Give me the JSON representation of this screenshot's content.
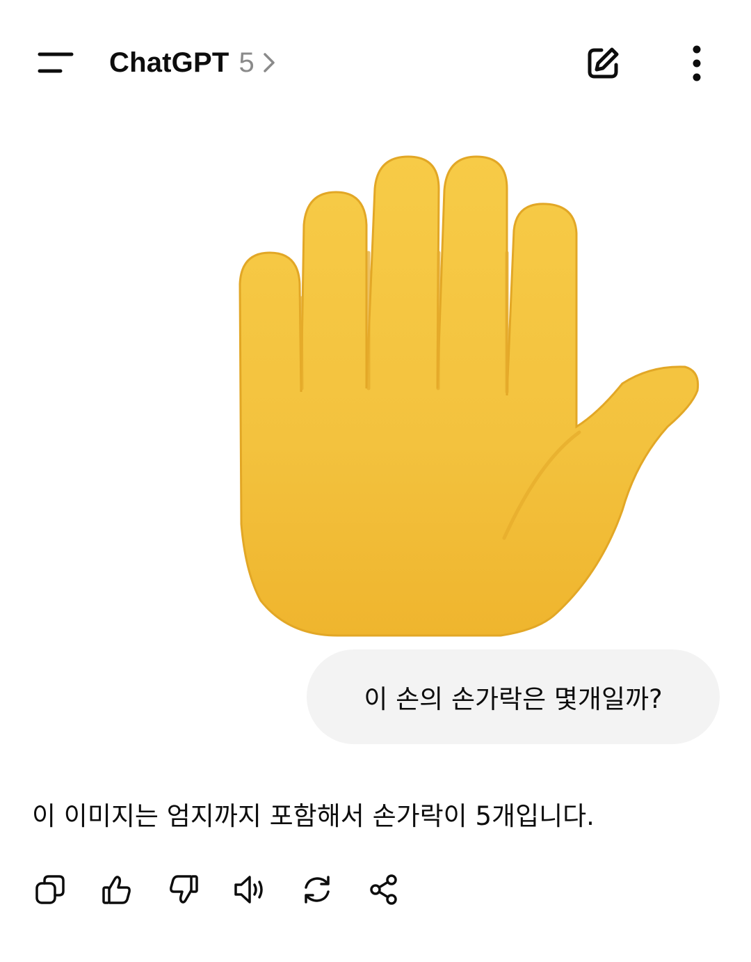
{
  "header": {
    "title": "ChatGPT",
    "version": "5",
    "icons": {
      "menu": "menu-icon",
      "chevron": "chevron-right-icon",
      "new_chat": "edit-icon",
      "more": "more-vertical-icon"
    }
  },
  "conversation": {
    "user_image": {
      "icon": "raised-hand-emoji-image",
      "colors": {
        "hand": "#F5C542",
        "shadow": "#E0A820"
      }
    },
    "user_message": "이 손의 손가락은 몇개일까?",
    "assistant_message": "이 이미지는 엄지까지 포함해서 손가락이 5개입니다."
  },
  "actions": [
    {
      "name": "copy",
      "icon": "copy-icon"
    },
    {
      "name": "good-response",
      "icon": "thumbs-up-icon"
    },
    {
      "name": "bad-response",
      "icon": "thumbs-down-icon"
    },
    {
      "name": "read-aloud",
      "icon": "speaker-icon"
    },
    {
      "name": "regenerate",
      "icon": "refresh-icon"
    },
    {
      "name": "share",
      "icon": "share-icon"
    }
  ],
  "colors": {
    "bubble_bg": "#F3F3F3",
    "text": "#0D0D0D",
    "muted": "#8A8A8A"
  }
}
